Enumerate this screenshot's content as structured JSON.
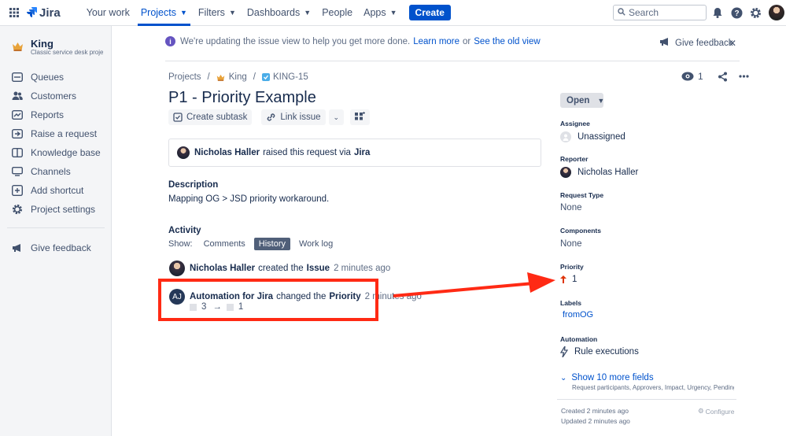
{
  "topnav": {
    "logo_text": "Jira",
    "items": [
      {
        "label": "Your work",
        "has_chevron": false,
        "active": false
      },
      {
        "label": "Projects",
        "has_chevron": true,
        "active": true
      },
      {
        "label": "Filters",
        "has_chevron": true,
        "active": false
      },
      {
        "label": "Dashboards",
        "has_chevron": true,
        "active": false
      },
      {
        "label": "People",
        "has_chevron": false,
        "active": false
      },
      {
        "label": "Apps",
        "has_chevron": true,
        "active": false
      }
    ],
    "create_label": "Create",
    "search_placeholder": "Search",
    "icons": [
      "notifications-icon",
      "help-icon",
      "settings-icon"
    ]
  },
  "sidebar": {
    "project_name": "King",
    "project_type": "Classic service desk project",
    "items": [
      {
        "label": "Queues",
        "icon": "queues-icon"
      },
      {
        "label": "Customers",
        "icon": "customers-icon"
      },
      {
        "label": "Reports",
        "icon": "reports-icon"
      },
      {
        "label": "Raise a request",
        "icon": "raise-request-icon"
      },
      {
        "label": "Knowledge base",
        "icon": "knowledge-base-icon"
      },
      {
        "label": "Channels",
        "icon": "channels-icon"
      },
      {
        "label": "Add shortcut",
        "icon": "add-shortcut-icon"
      },
      {
        "label": "Project settings",
        "icon": "settings-icon"
      }
    ],
    "feedback_label": "Give feedback"
  },
  "banner": {
    "text": "We're updating the issue view to help you get more done.",
    "learn_more": "Learn more",
    "or": "or",
    "old_view": "See the old view",
    "feedback_label": "Give feedback"
  },
  "breadcrumb": {
    "projects": "Projects",
    "project": "King",
    "issue_key": "KING-15"
  },
  "issue": {
    "title": "P1 - Priority Example",
    "create_subtask": "Create subtask",
    "link_issue": "Link issue",
    "raised_by": "Nicholas Haller",
    "raised_text": "raised this request via",
    "raised_via": "Jira",
    "description_heading": "Description",
    "description_text": "Mapping OG > JSD priority workaround."
  },
  "activity": {
    "heading": "Activity",
    "show_label": "Show:",
    "tabs": [
      {
        "label": "Comments",
        "selected": false
      },
      {
        "label": "History",
        "selected": true
      },
      {
        "label": "Work log",
        "selected": false
      }
    ],
    "entries": [
      {
        "author": "Nicholas Haller",
        "action": "created the",
        "object": "Issue",
        "time": "2 minutes ago"
      },
      {
        "avatar": "AJ",
        "author": "Automation for Jira",
        "action": "changed the",
        "object": "Priority",
        "time": "2 minutes ago",
        "from": "3",
        "to": "1"
      }
    ]
  },
  "right_panel": {
    "watchers_count": "1",
    "status": "Open",
    "assignee_label": "Assignee",
    "assignee_value": "Unassigned",
    "reporter_label": "Reporter",
    "reporter_value": "Nicholas Haller",
    "request_type_label": "Request Type",
    "request_type_value": "None",
    "components_label": "Components",
    "components_value": "None",
    "priority_label": "Priority",
    "priority_value": "1",
    "labels_label": "Labels",
    "labels_value": "fromOG",
    "automation_label": "Automation",
    "automation_value": "Rule executions",
    "show_more": "Show 10 more fields",
    "show_more_sub": "Request participants, Approvers, Impact, Urgency, Pending reason",
    "created": "Created 2 minutes ago",
    "updated": "Updated 2 minutes ago",
    "configure": "Configure"
  },
  "colors": {
    "brand": "#0052cc",
    "annotation_red": "#ff2a14",
    "priority_red": "#de350b"
  }
}
